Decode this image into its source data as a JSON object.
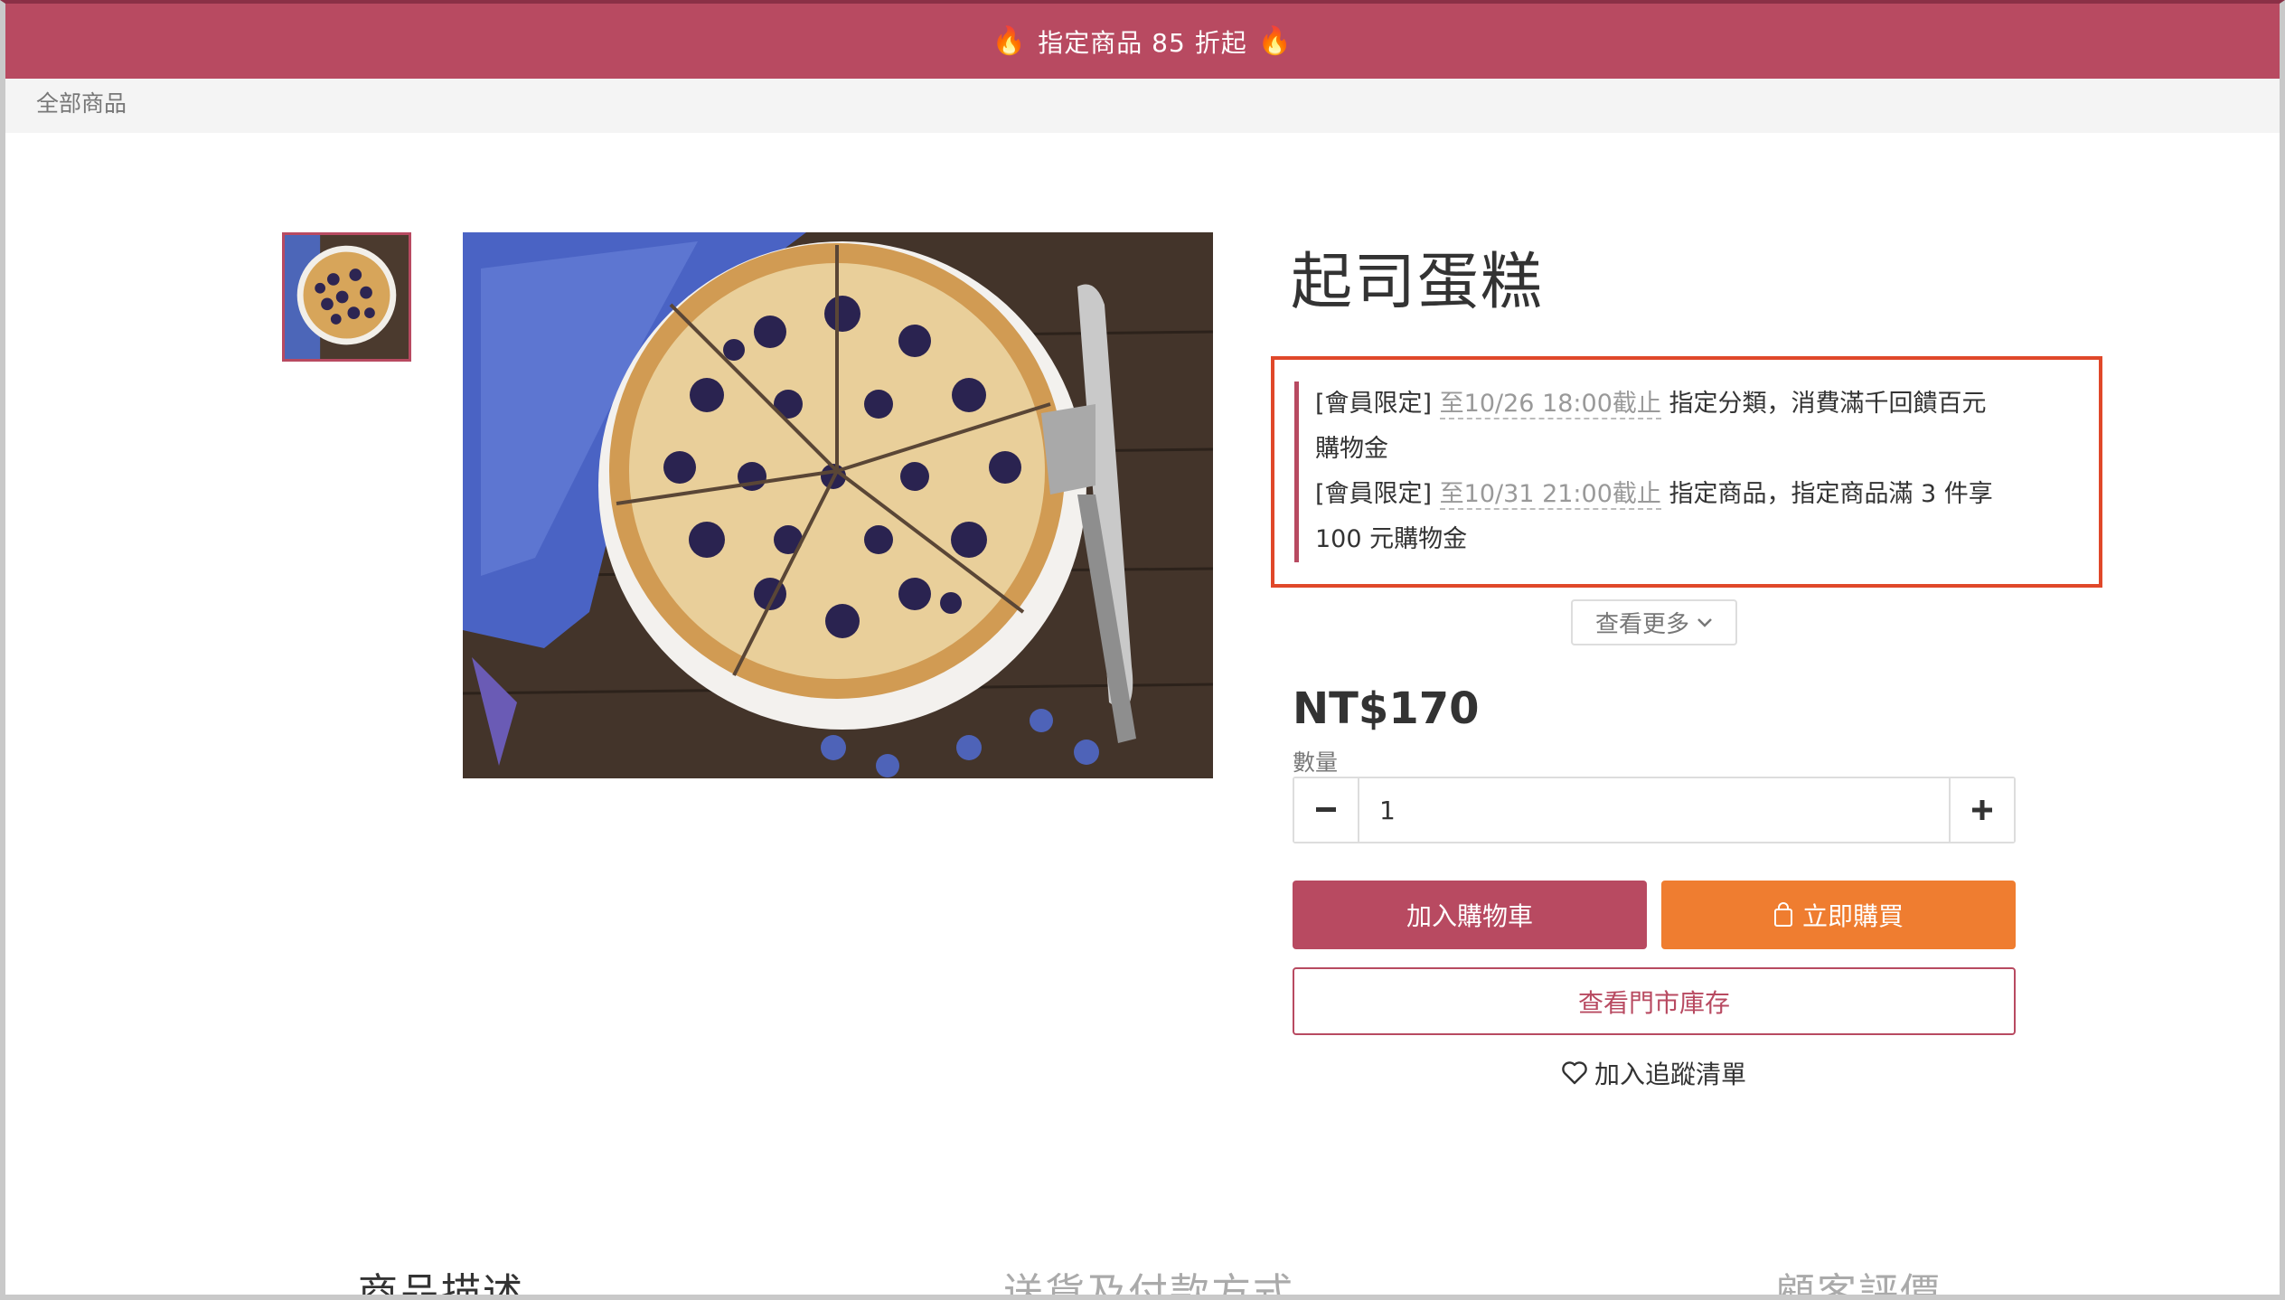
{
  "promo_bar": {
    "text": "指定商品 85 折起",
    "icon_left": "fire-icon",
    "icon_right": "fire-icon",
    "background": "#b84a61"
  },
  "breadcrumb": {
    "label": "全部商品"
  },
  "product": {
    "title": "起司蛋糕",
    "price": "NT$170",
    "image_alt": "blueberry cheesecake"
  },
  "promotions": [
    {
      "tag": "[會員限定]",
      "date": "至10/26 18:00截止",
      "text_line1": "指定分類，消費滿千回饋百元",
      "text_line2": "購物金"
    },
    {
      "tag": "[會員限定]",
      "date": "至10/31 21:00截止",
      "text_line1": "指定商品，指定商品滿 3 件享",
      "text_line2": "100 元購物金"
    }
  ],
  "see_more": {
    "label": "查看更多"
  },
  "quantity": {
    "label": "數量",
    "value": "1"
  },
  "buttons": {
    "add_to_cart": "加入購物車",
    "buy_now": "立即購買",
    "check_store_stock": "查看門市庫存",
    "wishlist": "加入追蹤清單"
  },
  "tabs": [
    {
      "label": "商品描述",
      "active": true
    },
    {
      "label": "送貨及付款方式",
      "active": false
    },
    {
      "label": "顧客評價",
      "active": false
    }
  ],
  "colors": {
    "brand": "#b84a61",
    "buy_now": "#ef7d30",
    "highlight_box": "#e0482a"
  }
}
